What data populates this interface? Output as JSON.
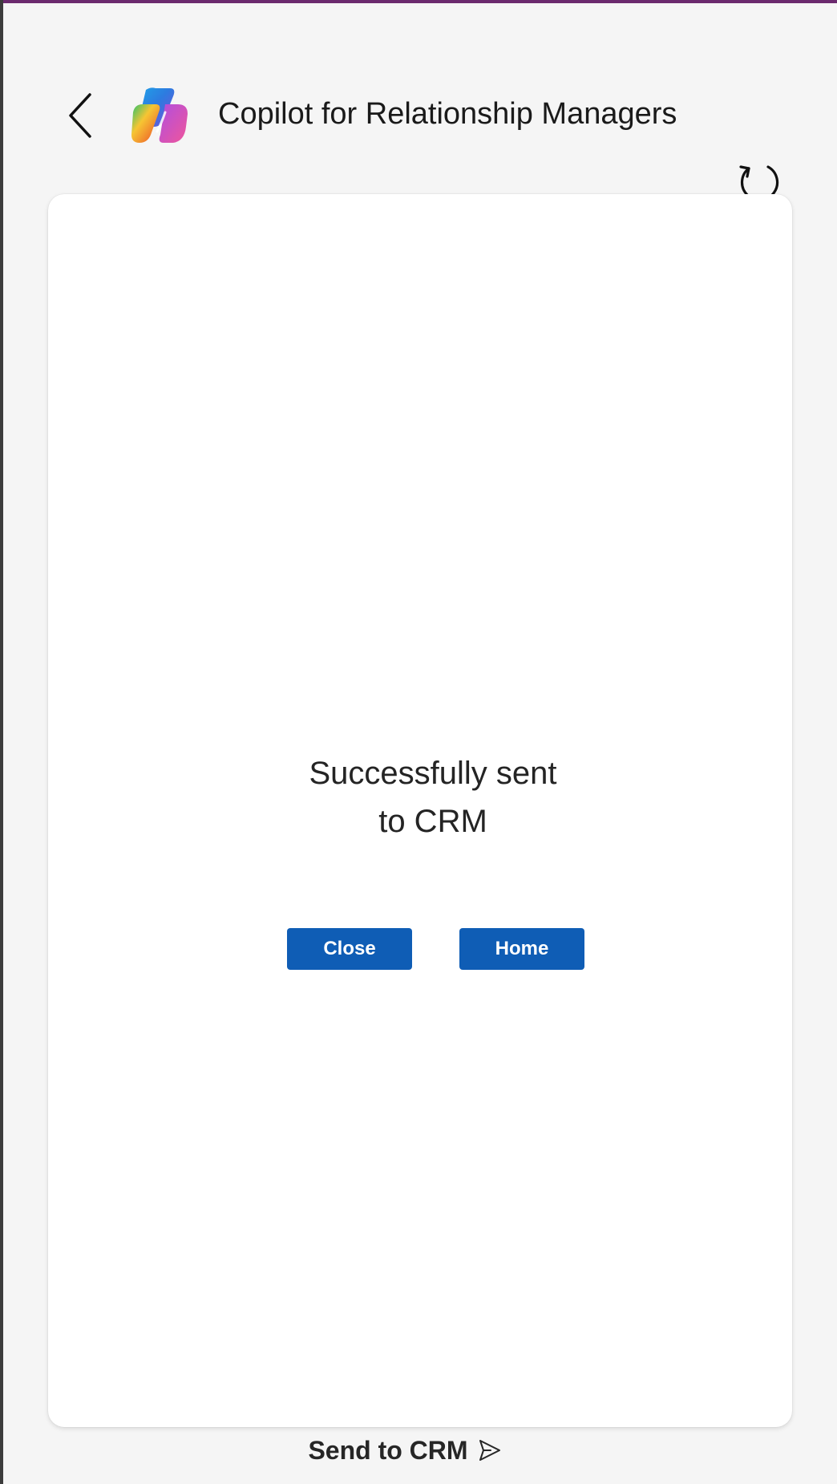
{
  "header": {
    "title": "Copilot for Relationship Managers",
    "back_icon": "chevron-left-icon",
    "logo": "copilot-logo-icon",
    "refresh_icon": "refresh-icon"
  },
  "confirmation": {
    "message_line1": "Successfully sent",
    "message_line2": "to CRM",
    "close_label": "Close",
    "home_label": "Home"
  },
  "footer": {
    "send_label": "Send to CRM",
    "send_icon": "send-icon"
  },
  "colors": {
    "accent": "#6b2a6e",
    "primary_button": "#0f5db5",
    "background": "#f5f5f5",
    "card": "#ffffff"
  }
}
